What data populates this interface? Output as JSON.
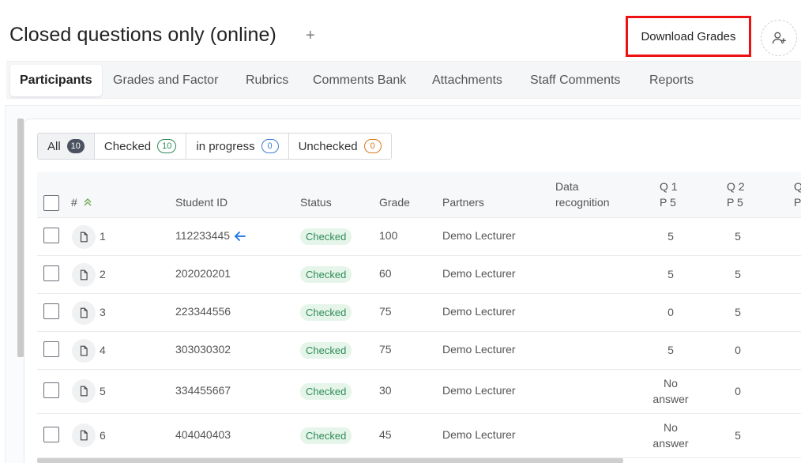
{
  "page": {
    "title": "Closed questions only (online)",
    "title_add": "+",
    "download_label": "Download Grades"
  },
  "tabs": [
    "Participants",
    "Grades and Factor",
    "Rubrics",
    "Comments Bank",
    "Attachments",
    "Staff Comments",
    "Reports"
  ],
  "filters": [
    {
      "label": "All",
      "count": "10"
    },
    {
      "label": "Checked",
      "count": "10"
    },
    {
      "label": "in progress",
      "count": "0"
    },
    {
      "label": "Unchecked",
      "count": "0"
    }
  ],
  "columns": {
    "index": "#",
    "student_id": "Student ID",
    "status": "Status",
    "grade": "Grade",
    "partners": "Partners",
    "data_recognition_1": "Data",
    "data_recognition_2": "recognition",
    "q1_1": "Q 1",
    "q1_2": "P 5",
    "q2_1": "Q 2",
    "q2_2": "P 5",
    "q3_1": "Q",
    "q3_2": "P"
  },
  "rows": [
    {
      "index": "1",
      "student_id": "112233445",
      "status": "Checked",
      "grade": "100",
      "partner": "Demo Lecturer",
      "q1": "5",
      "q1b": "",
      "q2": "5",
      "current": true
    },
    {
      "index": "2",
      "student_id": "202020201",
      "status": "Checked",
      "grade": "60",
      "partner": "Demo Lecturer",
      "q1": "5",
      "q1b": "",
      "q2": "5"
    },
    {
      "index": "3",
      "student_id": "223344556",
      "status": "Checked",
      "grade": "75",
      "partner": "Demo Lecturer",
      "q1": "0",
      "q1b": "",
      "q2": "5"
    },
    {
      "index": "4",
      "student_id": "303030302",
      "status": "Checked",
      "grade": "75",
      "partner": "Demo Lecturer",
      "q1": "5",
      "q1b": "",
      "q2": "0"
    },
    {
      "index": "5",
      "student_id": "334455667",
      "status": "Checked",
      "grade": "30",
      "partner": "Demo Lecturer",
      "q1": "No",
      "q1b": "answer",
      "q2": "0"
    },
    {
      "index": "6",
      "student_id": "404040403",
      "status": "Checked",
      "grade": "45",
      "partner": "Demo Lecturer",
      "q1": "No",
      "q1b": "answer",
      "q2": "5"
    }
  ],
  "colors": {
    "highlight_border": "#ee1111",
    "status_green": "#2e8b57",
    "status_bg": "#e6f5ea",
    "arrow_blue": "#1a73e8"
  }
}
